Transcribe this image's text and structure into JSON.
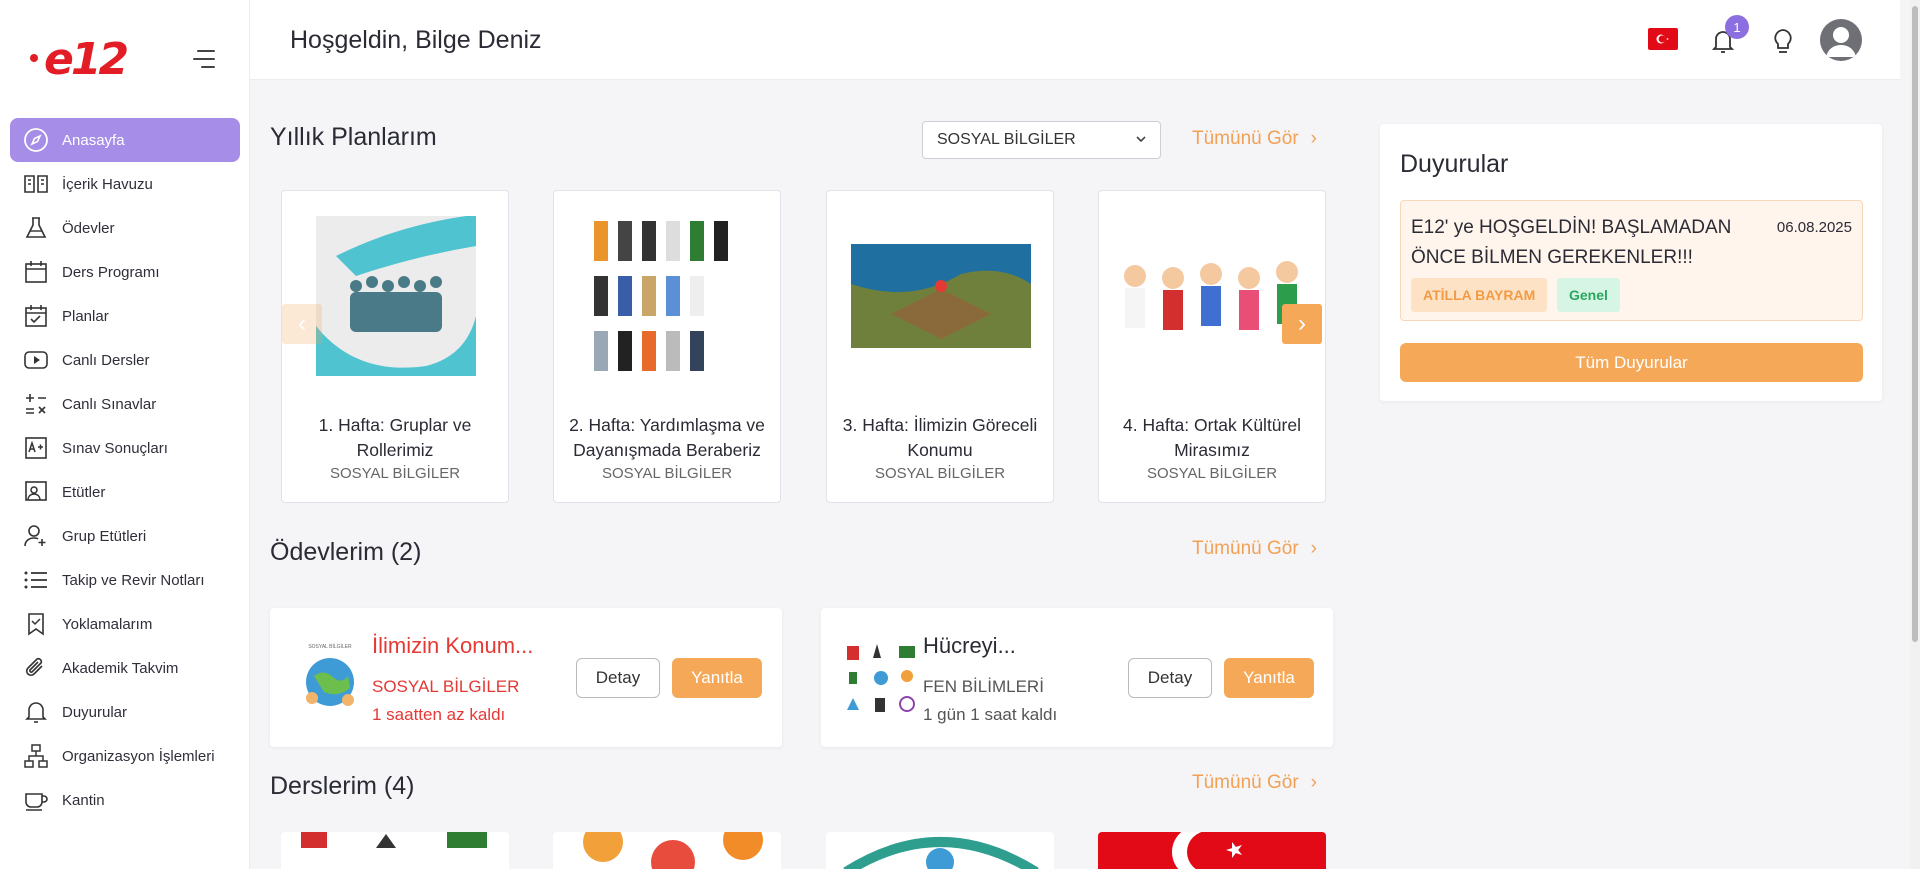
{
  "app": {
    "logo_text": "e12"
  },
  "header": {
    "welcome": "Hoşgeldin, Bilge Deniz",
    "notification_count": "1"
  },
  "sidebar": {
    "items": [
      {
        "label": "Anasayfa",
        "icon": "compass-icon",
        "active": true
      },
      {
        "label": "İçerik Havuzu",
        "icon": "book-open-icon"
      },
      {
        "label": "Ödevler",
        "icon": "flask-icon"
      },
      {
        "label": "Ders Programı",
        "icon": "calendar-icon"
      },
      {
        "label": "Planlar",
        "icon": "calendar-check-icon"
      },
      {
        "label": "Canlı Dersler",
        "icon": "play-icon"
      },
      {
        "label": "Canlı Sınavlar",
        "icon": "math-operators-icon"
      },
      {
        "label": "Sınav Sonuçları",
        "icon": "grade-icon"
      },
      {
        "label": "Etütler",
        "icon": "presentation-icon"
      },
      {
        "label": "Grup Etütleri",
        "icon": "user-add-icon"
      },
      {
        "label": "Takip ve Revir Notları",
        "icon": "list-icon"
      },
      {
        "label": "Yoklamalarım",
        "icon": "bookmark-check-icon"
      },
      {
        "label": "Akademik Takvim",
        "icon": "paperclip-icon"
      },
      {
        "label": "Duyurular",
        "icon": "bell-icon"
      },
      {
        "label": "Organizasyon İşlemleri",
        "icon": "org-chart-icon"
      },
      {
        "label": "Kantin",
        "icon": "cup-icon"
      }
    ]
  },
  "plans": {
    "title": "Yıllık Planlarım",
    "see_all": "Tümünü Gör",
    "selected_subject": "SOSYAL BİLGİLER",
    "cards": [
      {
        "title": "1. Hafta: Gruplar ve Rollerimiz",
        "subject": "SOSYAL BİLGİLER"
      },
      {
        "title": "2. Hafta: Yardımlaşma ve Dayanışmada Beraberiz",
        "subject": "SOSYAL BİLGİLER"
      },
      {
        "title": "3. Hafta: İlimizin Göreceli Konumu",
        "subject": "SOSYAL BİLGİLER"
      },
      {
        "title": "4. Hafta: Ortak Kültürel Mirasımız",
        "subject": "SOSYAL BİLGİLER"
      }
    ]
  },
  "homework": {
    "title": "Ödevlerim (2)",
    "see_all": "Tümünü Gör",
    "items": [
      {
        "title": "İlimizin Konum...",
        "subject": "SOSYAL BİLGİLER",
        "time_left": "1 saatten az kaldı",
        "detail": "Detay",
        "reply": "Yanıtla",
        "color": "#e53935"
      },
      {
        "title": "Hücreyi...",
        "subject": "FEN BİLİMLERİ",
        "time_left": "1 gün 1 saat kaldı",
        "detail": "Detay",
        "reply": "Yanıtla",
        "color": "#2b2b35"
      }
    ]
  },
  "courses": {
    "title": "Derslerim (4)",
    "see_all": "Tümünü Gör"
  },
  "announcements": {
    "title": "Duyurular",
    "item": {
      "text": "E12' ye HOŞGELDİN! BAŞLAMADAN ÖNCE BİLMEN GEREKENLER!!!",
      "date": "06.08.2025",
      "author": "ATİLLA BAYRAM",
      "category": "Genel"
    },
    "all_button": "Tüm Duyurular"
  },
  "colors": {
    "accent": "#a58de8",
    "orange": "#f5a958",
    "brand_red": "#e21d25"
  }
}
